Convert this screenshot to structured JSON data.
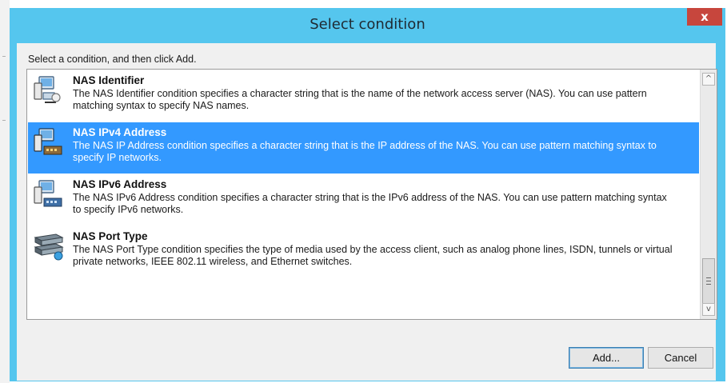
{
  "window": {
    "title": "Select condition",
    "close_label": "x"
  },
  "instruction": "Select a condition, and then click Add.",
  "conditions": [
    {
      "title": "NAS Identifier",
      "description": "The NAS Identifier condition specifies a character string that is the name of the network access server (NAS). You can use pattern matching syntax to specify NAS names.",
      "icon": "network-computer-icon",
      "selected": false
    },
    {
      "title": "NAS IPv4 Address",
      "description": "The NAS IP Address condition specifies a character string that is the IP address of the NAS. You can use pattern matching syntax to specify IP networks.",
      "icon": "network-ipv4-icon",
      "selected": true
    },
    {
      "title": "NAS IPv6 Address",
      "description": "The NAS IPv6 Address condition specifies a character string that is the IPv6 address of the NAS. You can use pattern matching syntax to specify IPv6 networks.",
      "icon": "network-ipv6-icon",
      "selected": false
    },
    {
      "title": "NAS Port Type",
      "description": "The NAS Port Type condition specifies the type of media used by the access client, such as analog phone lines, ISDN, tunnels or virtual private networks, IEEE 802.11 wireless, and Ethernet switches.",
      "icon": "port-type-icon",
      "selected": false
    }
  ],
  "buttons": {
    "add_label": "Add...",
    "cancel_label": "Cancel"
  },
  "scrollbar": {
    "up_arrow": "^",
    "down_arrow": "v",
    "position": 0.85
  },
  "colors": {
    "title_bar": "#55c6ee",
    "selection": "#3399ff",
    "close_button": "#c7463d"
  }
}
